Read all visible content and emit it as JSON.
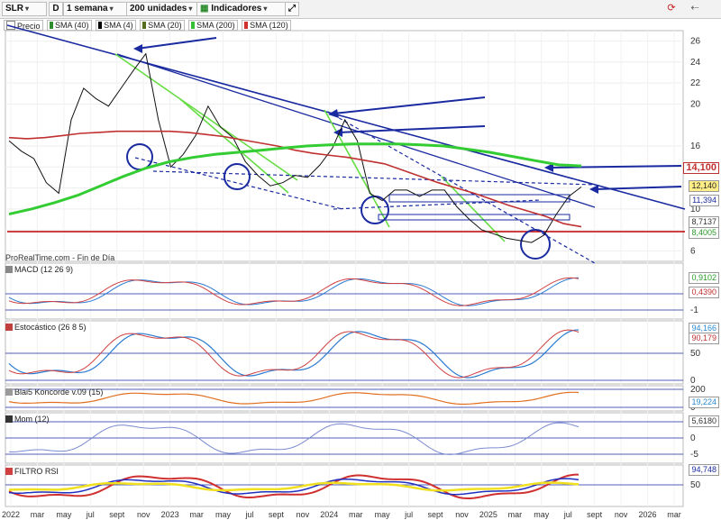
{
  "toolbar": {
    "symbol": "SLR",
    "d_button": "D",
    "period": "1 semana",
    "units": "200 unidades",
    "indicators": "Indicadores",
    "icons": [
      "expand-icon",
      "refresh-icon",
      "arrow-left-icon"
    ]
  },
  "legend": {
    "items": [
      {
        "label": "Precio",
        "color": "#ffffff"
      },
      {
        "label": "SMA (40)",
        "color": "#2e8b2e"
      },
      {
        "label": "SMA (4)",
        "color": "#000000"
      },
      {
        "label": "SMA (20)",
        "color": "#556b1e"
      },
      {
        "label": "SMA (200)",
        "color": "#35c035"
      },
      {
        "label": "SMA (120)",
        "color": "#d03030"
      }
    ]
  },
  "footer_note": "ProRealTime.com - Fin de Día",
  "colors": {
    "trend": "#1a2aa0",
    "sma120": "#c03030",
    "sma200": "#33cc33",
    "resistance": "#c00000",
    "green_trend": "#66dd44"
  },
  "price_badges": {
    "target": "14,100",
    "current": "12,140",
    "b1": "11,394",
    "b2": "8,7137",
    "b3": "8,4005"
  },
  "panels": {
    "macd": {
      "title": "MACD (12 26 9)",
      "badges": [
        "0,9102",
        "0,4390"
      ],
      "ticks": [
        "0",
        "-1"
      ]
    },
    "stoch": {
      "title": "Estocástico (26 8 5)",
      "badges": [
        "94,166",
        "90,179"
      ],
      "ticks": [
        "50",
        "0"
      ]
    },
    "blai": {
      "title": "Blai5 Koncorde v.09 (15)",
      "badges": [
        "19,224"
      ],
      "ticks": [
        "200",
        "0"
      ]
    },
    "mom": {
      "title": "Mom (12)",
      "badges": [
        "5,6180"
      ],
      "ticks": [
        "5",
        "0",
        "-5"
      ]
    },
    "rsi": {
      "title": "FILTRO RSI",
      "badges": [
        "94,748"
      ],
      "ticks": [
        "50"
      ]
    }
  },
  "chart_data": {
    "type": "line",
    "title": "SLR",
    "y_axis_ticks": [
      26,
      24,
      22,
      20,
      16,
      14,
      12,
      10,
      8,
      6
    ],
    "ylim": [
      5,
      27
    ],
    "x_axis_ticks": [
      "2022",
      "mar",
      "may",
      "jul",
      "sept",
      "nov",
      "2023",
      "mar",
      "may",
      "jul",
      "sept",
      "nov",
      "2024",
      "mar",
      "may",
      "jul",
      "sept",
      "nov",
      "2025",
      "mar",
      "may",
      "jul",
      "sept",
      "nov",
      "2026",
      "mar"
    ],
    "series": [
      {
        "name": "Precio",
        "values": [
          16.5,
          15.5,
          14.8,
          12.5,
          11.5,
          18.5,
          21.5,
          20.5,
          19.8,
          21.5,
          23.2,
          24.8,
          18.5,
          14.0,
          15.2,
          17.0,
          19.8,
          17.8,
          16.8,
          14.5,
          13.2,
          12.2,
          12.5,
          13.2,
          13.0,
          14.2,
          15.8,
          18.5,
          16.5,
          11.5,
          10.8,
          11.8,
          11.8,
          11.2,
          11.8,
          11.8,
          10.2,
          9.0,
          8.0,
          7.6,
          7.2,
          7.0,
          6.8,
          7.5,
          9.5,
          11.2,
          12.1
        ]
      },
      {
        "name": "SMA (120)",
        "values": [
          16.8,
          16.7,
          16.8,
          17.0,
          17.2,
          17.3,
          17.4,
          17.4,
          17.4,
          17.4,
          17.3,
          17.1,
          16.9,
          16.6,
          16.3,
          16.0,
          15.6,
          15.3,
          15.1,
          14.9,
          14.6,
          14.3,
          13.7,
          13.1,
          12.5,
          12.0,
          11.5,
          10.9,
          10.3,
          9.8,
          9.3,
          8.6,
          8.3
        ]
      },
      {
        "name": "SMA (200)",
        "values": [
          9.5,
          10.0,
          10.6,
          11.3,
          12.2,
          13.1,
          13.9,
          14.5,
          14.9,
          15.2,
          15.4,
          15.6,
          15.8,
          16.0,
          16.1,
          16.2,
          16.2,
          16.2,
          16.1,
          16.0,
          15.7,
          15.4,
          15.0,
          14.6,
          14.2,
          14.1
        ]
      }
    ],
    "annotations": [
      "14,100"
    ]
  }
}
